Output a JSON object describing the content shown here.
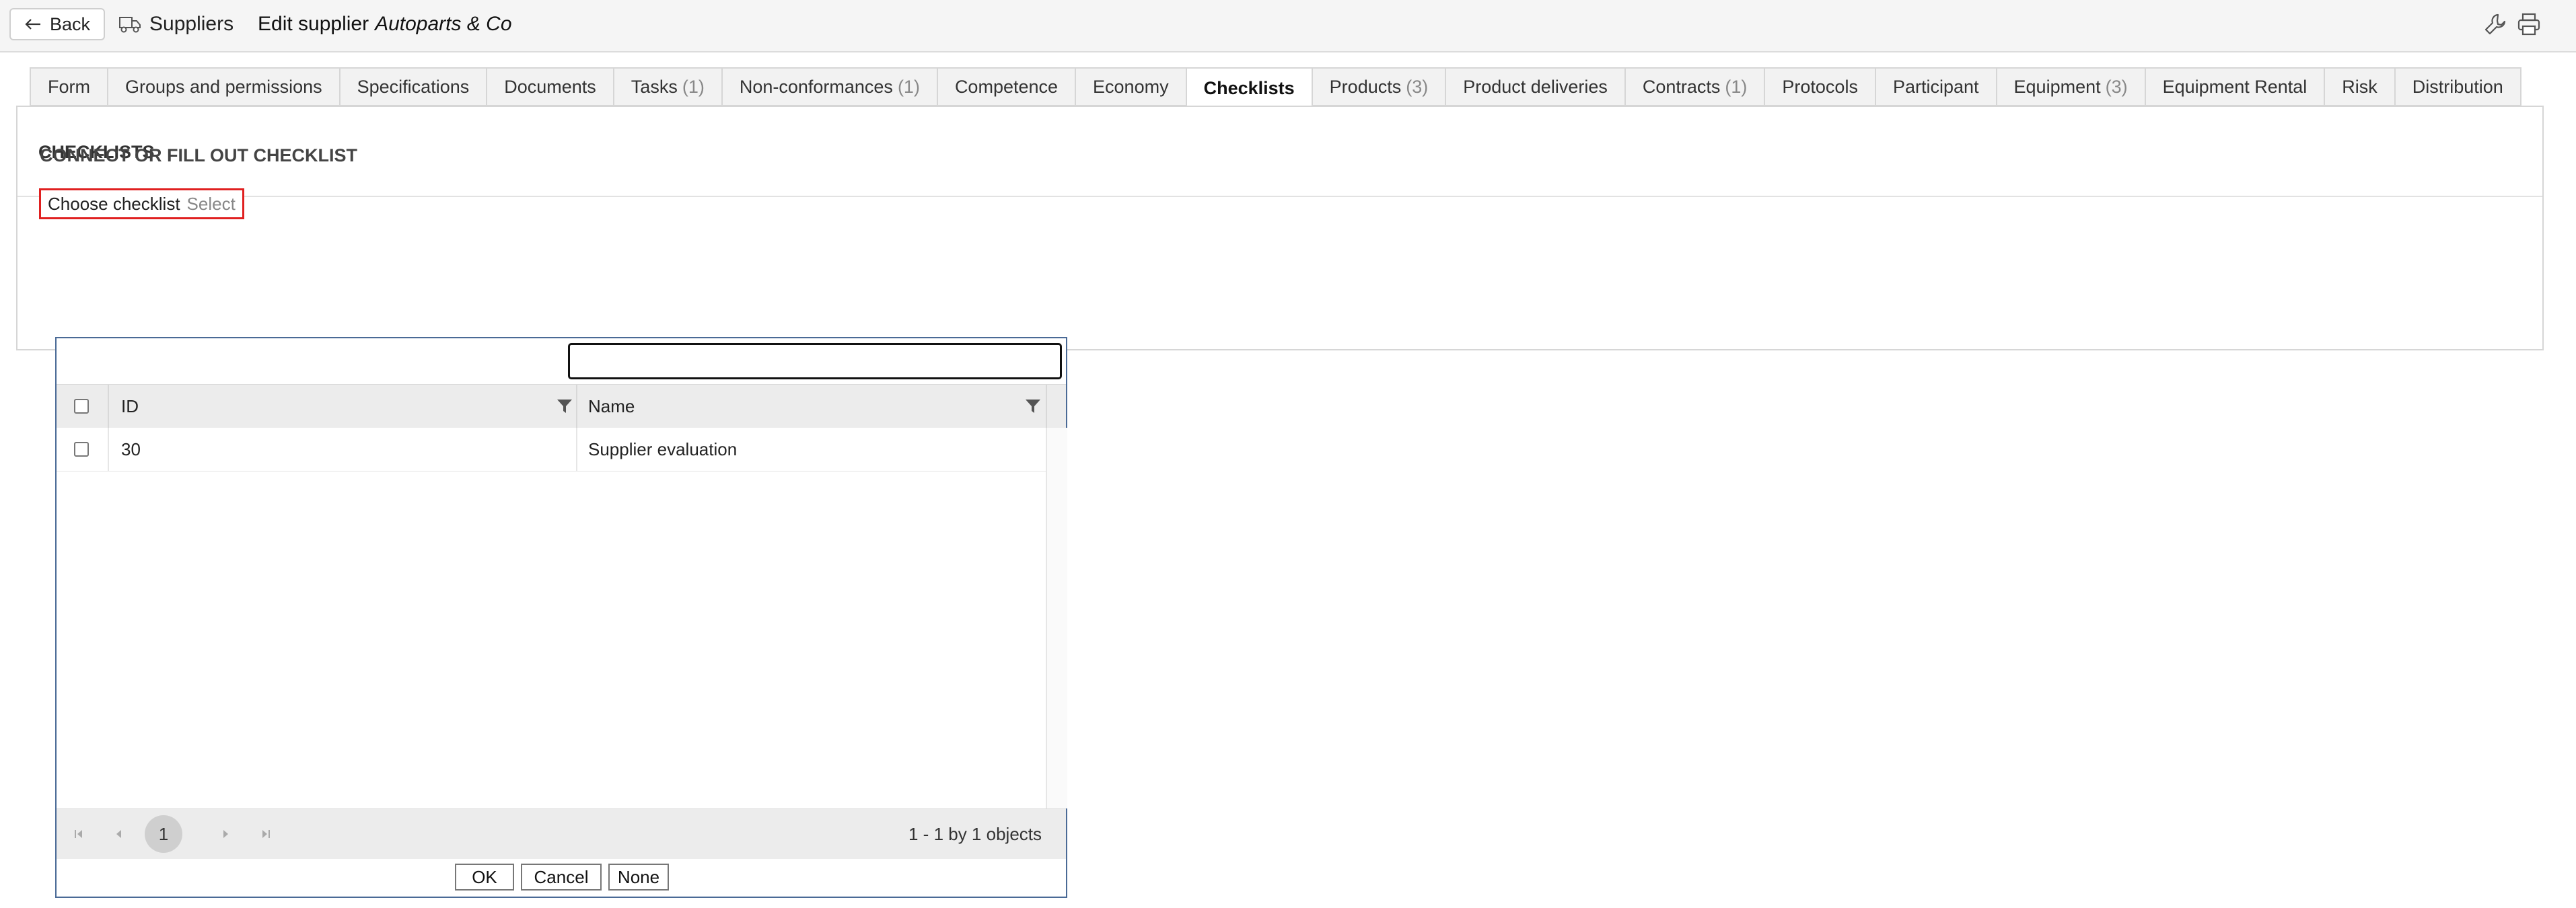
{
  "topbar": {
    "back_label": "Back",
    "breadcrumb": "Suppliers",
    "title_prefix": "Edit supplier",
    "title_entity": "Autoparts & Co"
  },
  "tabs": [
    {
      "label": "Form",
      "count": ""
    },
    {
      "label": "Groups and permissions",
      "count": ""
    },
    {
      "label": "Specifications",
      "count": ""
    },
    {
      "label": "Documents",
      "count": ""
    },
    {
      "label": "Tasks",
      "count": "(1)"
    },
    {
      "label": "Non-conformances",
      "count": "(1)"
    },
    {
      "label": "Competence",
      "count": ""
    },
    {
      "label": "Economy",
      "count": ""
    },
    {
      "label": "Checklists",
      "count": "",
      "active": true
    },
    {
      "label": "Products",
      "count": "(3)"
    },
    {
      "label": "Product deliveries",
      "count": ""
    },
    {
      "label": "Contracts",
      "count": "(1)"
    },
    {
      "label": "Protocols",
      "count": ""
    },
    {
      "label": "Participant",
      "count": ""
    },
    {
      "label": "Equipment",
      "count": "(3)"
    },
    {
      "label": "Equipment Rental",
      "count": ""
    },
    {
      "label": "Risk",
      "count": ""
    },
    {
      "label": "Distribution",
      "count": ""
    }
  ],
  "panel": {
    "title": "CHECKLISTS",
    "section_title": "CONNECT OR FILL OUT CHECKLIST",
    "choose_label": "Choose checklist",
    "choose_select": "Select"
  },
  "dialog": {
    "search_value": "",
    "columns": [
      "ID",
      "Name"
    ],
    "rows": [
      {
        "id": "30",
        "name": "Supplier evaluation"
      }
    ],
    "pager": {
      "current_page": "1",
      "info": "1 - 1 by 1 objects"
    },
    "buttons": {
      "ok": "OK",
      "cancel": "Cancel",
      "none": "None"
    }
  },
  "icons": {
    "back": "arrow-left-icon",
    "breadcrumb": "truck-icon",
    "tools": "wrench-icon",
    "print": "printer-icon",
    "filter": "filter-icon"
  }
}
